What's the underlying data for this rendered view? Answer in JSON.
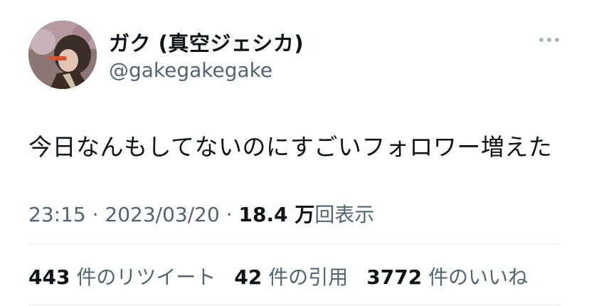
{
  "author": {
    "display_name": "ガク (真空ジェシカ)",
    "handle": "@gakegakegake"
  },
  "more_icon": "more-horizontal-icon",
  "tweet": {
    "text": "今日なんもしてないのにすごいフォロワー増えた"
  },
  "meta": {
    "time": "23:15",
    "separator": " · ",
    "date": "2023/03/20",
    "views_count": "18.4 万",
    "views_label": "回表示"
  },
  "stats": {
    "retweets": {
      "count": "443",
      "label": "件のリツイート"
    },
    "quotes": {
      "count": "42",
      "label": "件の引用"
    },
    "likes": {
      "count": "3772",
      "label": "件のいいね"
    }
  },
  "colors": {
    "primary_text": "#0f1419",
    "secondary_text": "#536471",
    "divider": "#e6ecf0"
  }
}
